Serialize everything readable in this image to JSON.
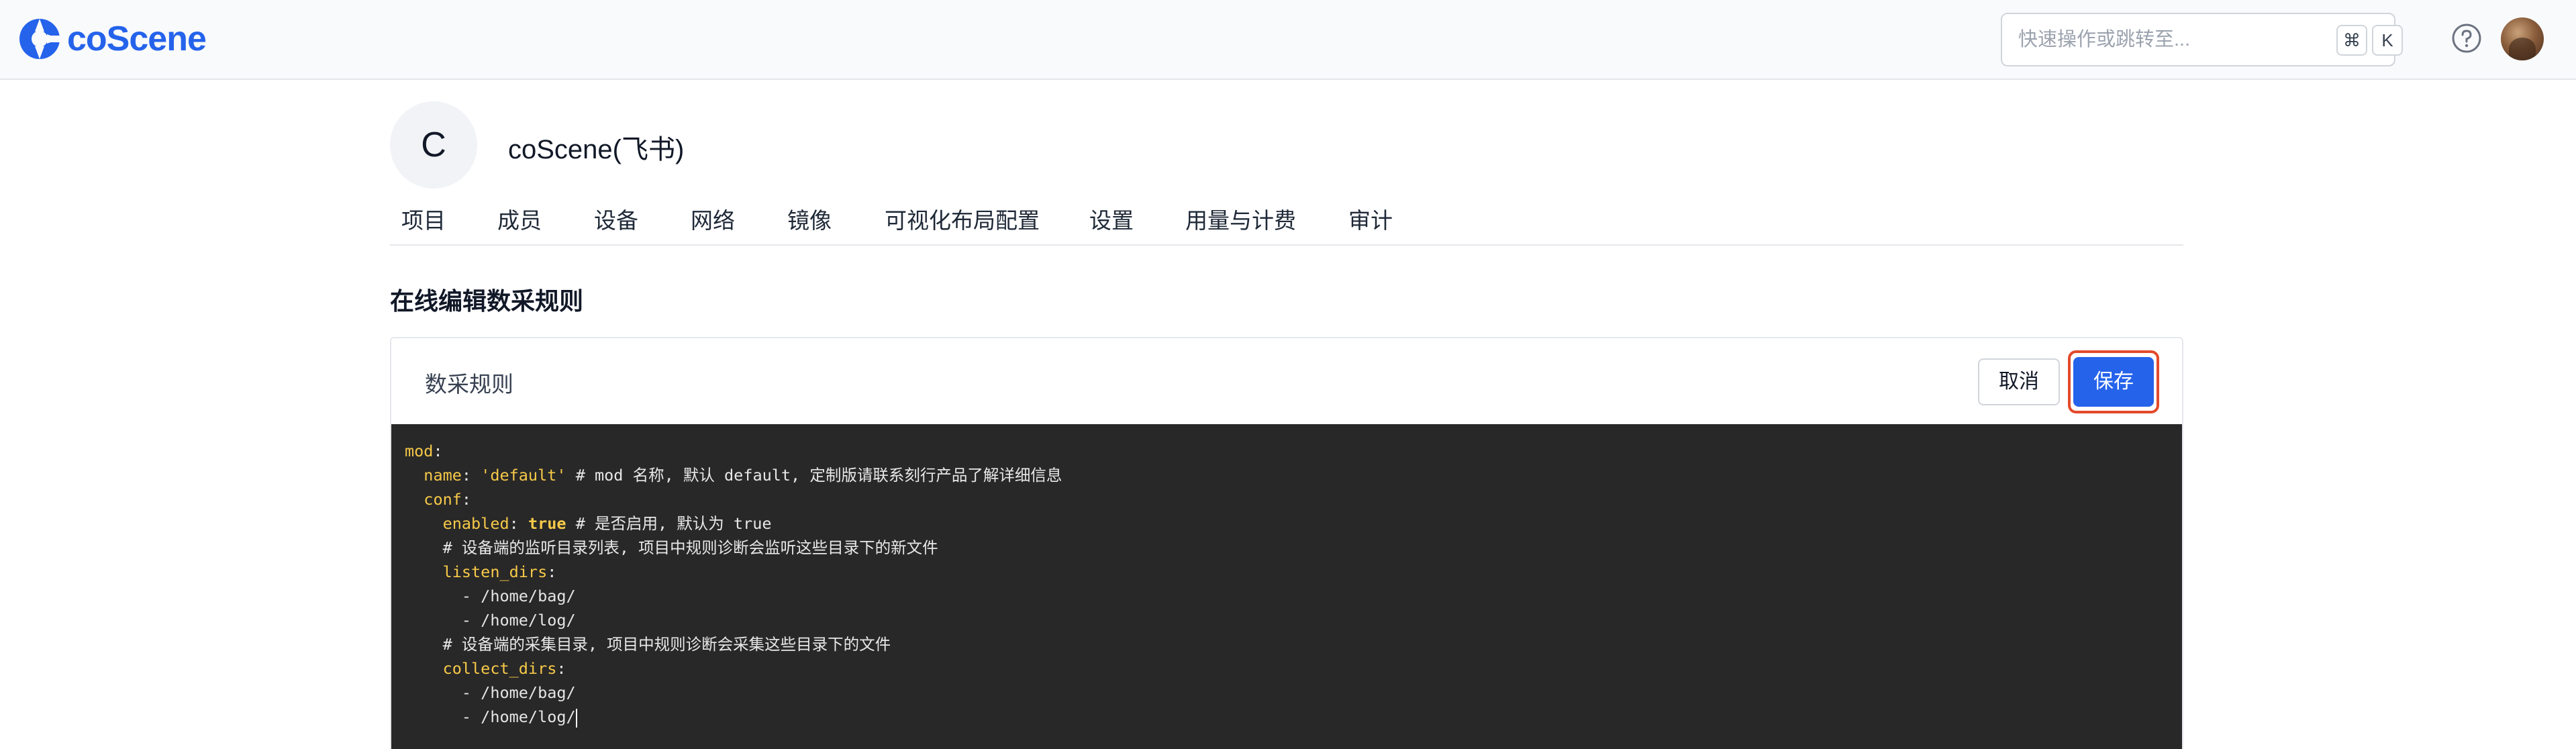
{
  "brand": {
    "name": "coScene",
    "color": "#2563eb"
  },
  "search": {
    "placeholder": "快速操作或跳转至...",
    "shortcut_cmd": "⌘",
    "shortcut_key": "K"
  },
  "org": {
    "avatar_letter": "C",
    "name": "coScene(飞书)"
  },
  "tabs": [
    {
      "label": "项目"
    },
    {
      "label": "成员"
    },
    {
      "label": "设备"
    },
    {
      "label": "网络"
    },
    {
      "label": "镜像"
    },
    {
      "label": "可视化布局配置"
    },
    {
      "label": "设置"
    },
    {
      "label": "用量与计费"
    },
    {
      "label": "审计"
    }
  ],
  "page": {
    "title": "在线编辑数采规则"
  },
  "editor": {
    "card_title": "数采规则",
    "cancel_label": "取消",
    "save_label": "保存",
    "lines": {
      "l1": "mod",
      "l2_key": "name",
      "l2_val": "'default'",
      "l2_comment": "# mod 名称, 默认 default, 定制版请联系刻行产品了解详细信息",
      "l3": "conf",
      "l4_key": "enabled",
      "l4_val": "true",
      "l4_comment": "# 是否启用, 默认为 true",
      "l5_comment": "# 设备端的监听目录列表, 项目中规则诊断会监听这些目录下的新文件",
      "l6": "listen_dirs",
      "l7": "- /home/bag/",
      "l8": "- /home/log/",
      "l9_comment": "# 设备端的采集目录, 项目中规则诊断会采集这些目录下的文件",
      "l10": "collect_dirs",
      "l11": "- /home/bag/",
      "l12": "- /home/log/"
    }
  },
  "colors": {
    "save_button": "#2563eb",
    "highlight_outline": "#e34a2b",
    "editor_bg": "#282828",
    "yaml_key": "#f7c948"
  }
}
